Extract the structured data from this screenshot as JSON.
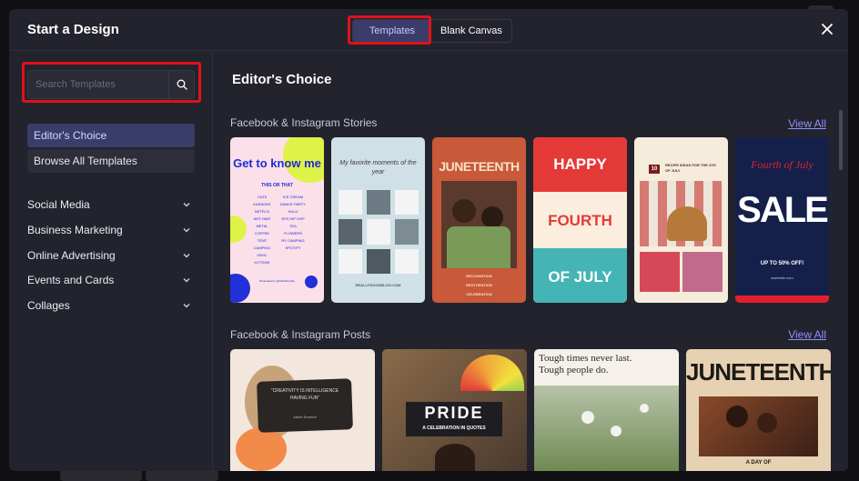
{
  "modal": {
    "title": "Start a Design",
    "tabs": [
      {
        "label": "Templates",
        "active": true
      },
      {
        "label": "Blank Canvas",
        "active": false
      }
    ]
  },
  "search": {
    "placeholder": "Search Templates",
    "icon": "search-icon"
  },
  "sidebar": {
    "nav": [
      {
        "label": "Editor's Choice",
        "active": true
      },
      {
        "label": "Browse All Templates",
        "active": false
      }
    ],
    "categories": [
      {
        "label": "Social Media"
      },
      {
        "label": "Business Marketing"
      },
      {
        "label": "Online Advertising"
      },
      {
        "label": "Events and Cards"
      },
      {
        "label": "Collages"
      }
    ]
  },
  "main": {
    "title": "Editor's Choice",
    "rows": [
      {
        "label": "Facebook & Instagram Stories",
        "view_all": "View All",
        "cards": [
          {
            "title": "Get to know me",
            "subtitle": "THIS OR THAT",
            "items_left": [
              "CATS",
              "KARAOKE",
              "NETFLIX",
              "80'S HAIR METAL",
              "COFFEE",
              "TENT CAMPING",
              "VINYL",
              "KITTENS"
            ],
            "items_right": [
              "ICE CREAM",
              "DANCE PARTY",
              "HULU",
              "90'S HIP HOP",
              "TEA",
              "FLOWERS",
              "RV CAMPING",
              "SPOTIFY"
            ],
            "footer": "Presented by @ArtfulSunday",
            "colors": {
              "bg": "#fbe0ea",
              "accent": "#dff247",
              "dot": "#2230d8",
              "text": "#1e2ad6"
            }
          },
          {
            "title": "My favorite moments of the year",
            "footer": "REALLYGOODBLOG.COM",
            "colors": {
              "bg": "#cfe0e6"
            }
          },
          {
            "title": "JUNETEENTH",
            "lines": [
              "RECOGNITION",
              "RESTORATION",
              "CELEBRATION"
            ],
            "colors": {
              "bg": "#c8593a"
            }
          },
          {
            "title_top": "HAPPY",
            "title_mid": "FOURTH",
            "title_bottom": "OF JULY",
            "colors": {
              "red": "#e43a37",
              "cream": "#fbeede",
              "teal": "#44b5b4"
            }
          },
          {
            "badge": "10",
            "title": "RECIPE IDEAS FOR THE 4TH OF JULY",
            "colors": {
              "bg": "#f6ecdc"
            }
          },
          {
            "title_top": "Fourth of July",
            "title_mid": "SALE",
            "line": "UP TO 50% OFF!",
            "footer": "awebsite.com",
            "colors": {
              "bg": "#14204a",
              "accent": "#e2202d"
            }
          }
        ]
      },
      {
        "label": "Facebook & Instagram Posts",
        "view_all": "View All",
        "cards": [
          {
            "quote": "\"CREATIVITY IS INTELLIGENCE HAVING FUN\"",
            "author": "Albert Einstein",
            "colors": {
              "bg": "#f3e6dc"
            }
          },
          {
            "title": "PRIDE",
            "subtitle": "A CELEBRATION IN QUOTES",
            "colors": {
              "bg": "#6b4a2e"
            }
          },
          {
            "line1": "Tough times never last.",
            "line2": "Tough people do.",
            "colors": {
              "bg": "#f5f1ea"
            }
          },
          {
            "title": "JUNETEENTH",
            "footer": "A DAY OF",
            "colors": {
              "bg": "#e6d2b2"
            }
          }
        ]
      }
    ]
  },
  "colors": {
    "modal_bg": "#23232d",
    "accent": "#3a3c6a",
    "link": "#8d90ff",
    "highlight": "#e0121b"
  }
}
